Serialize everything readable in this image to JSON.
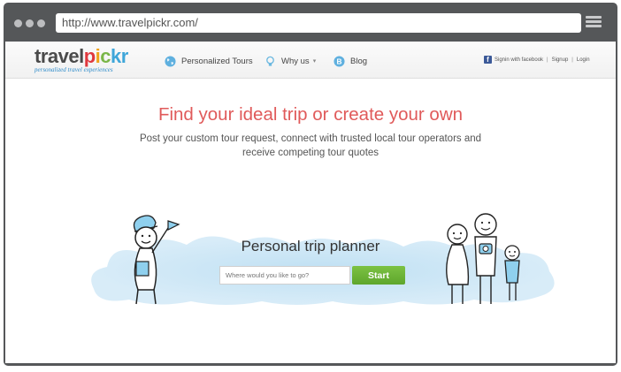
{
  "browser": {
    "url": "http://www.travelpickr.com/"
  },
  "header": {
    "logo_parts": [
      "travel",
      "p",
      "i",
      "c",
      "kr"
    ],
    "tagline": "personalized travel experiences",
    "nav": [
      {
        "label": "Personalized Tours",
        "icon": "globe-icon"
      },
      {
        "label": "Why us",
        "icon": "lightbulb-icon"
      },
      {
        "label": "Blog",
        "icon": "blogger-icon"
      }
    ],
    "facebook_signin": "Signin with facebook",
    "signup": "Signup",
    "login": "Login",
    "separator": "|"
  },
  "hero": {
    "headline": "Find your ideal trip or create your own",
    "subline_1": "Post your custom tour request, connect with trusted local tour operators and",
    "subline_2": "receive competing tour quotes"
  },
  "planner": {
    "title": "Personal trip planner",
    "placeholder": "Where would you like to go?",
    "start_label": "Start"
  },
  "colors": {
    "brand_red": "#e05a5a",
    "brand_blue": "#2c8ac9",
    "button_green": "#6ab435",
    "facebook_blue": "#3b5998"
  }
}
